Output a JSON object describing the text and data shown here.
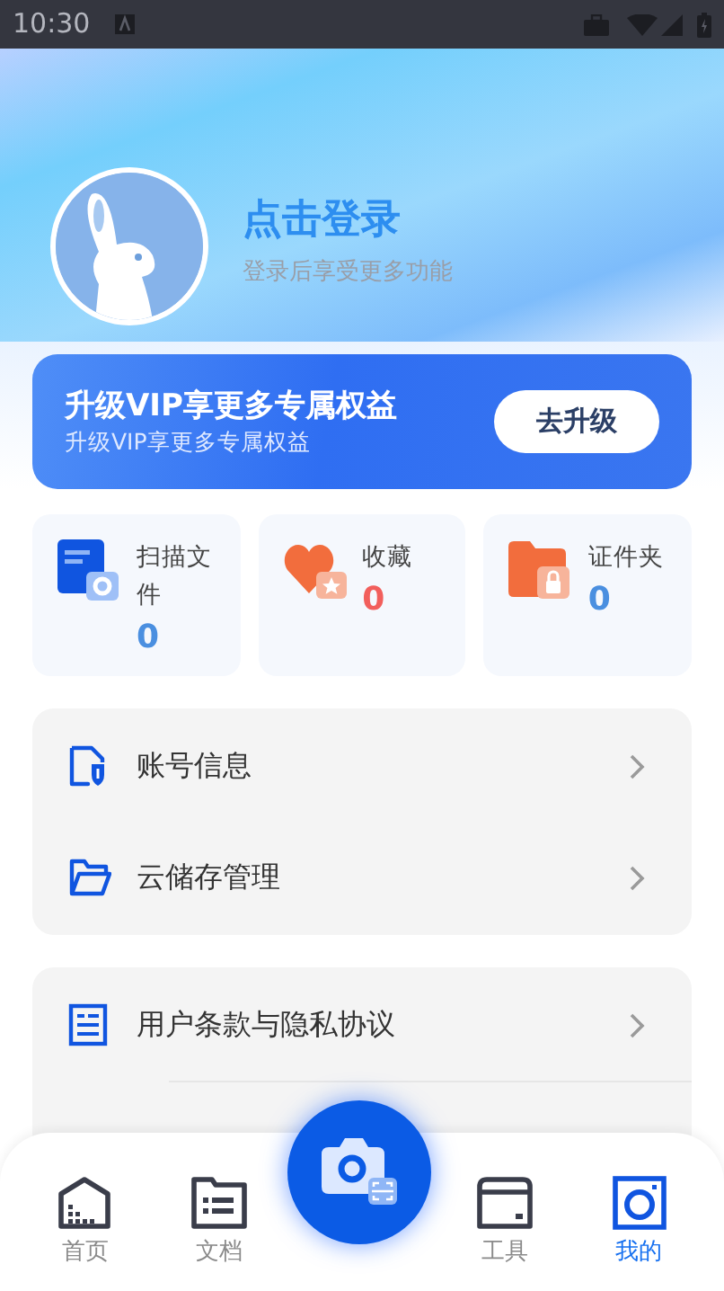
{
  "status_bar": {
    "time": "10:30"
  },
  "profile": {
    "title": "点击登录",
    "subtitle": "登录后享受更多功能"
  },
  "vip_banner": {
    "title": "升级VIP享更多专属权益",
    "subtitle": "升级VIP享更多专属权益",
    "button": "去升级"
  },
  "stats": [
    {
      "kind": "scan",
      "label": "扫描文件",
      "count": "0",
      "color": "#4a8fe0"
    },
    {
      "kind": "favorite",
      "label": "收藏",
      "count": "0",
      "color": "#f25f5c"
    },
    {
      "kind": "certificate",
      "label": "证件夹",
      "count": "0",
      "color": "#4a8fe0"
    }
  ],
  "menu_groups": [
    {
      "items": [
        {
          "kind": "account",
          "label": "账号信息"
        },
        {
          "kind": "cloud",
          "label": "云储存管理"
        }
      ]
    },
    {
      "items": [
        {
          "kind": "terms",
          "label": "用户条款与隐私协议"
        }
      ]
    }
  ],
  "bottom_nav": [
    {
      "kind": "home",
      "label": "首页",
      "selected": false
    },
    {
      "kind": "docs",
      "label": "文档",
      "selected": false
    },
    {
      "kind": "tools",
      "label": "工具",
      "selected": false
    },
    {
      "kind": "mine",
      "label": "我的",
      "selected": true
    }
  ]
}
